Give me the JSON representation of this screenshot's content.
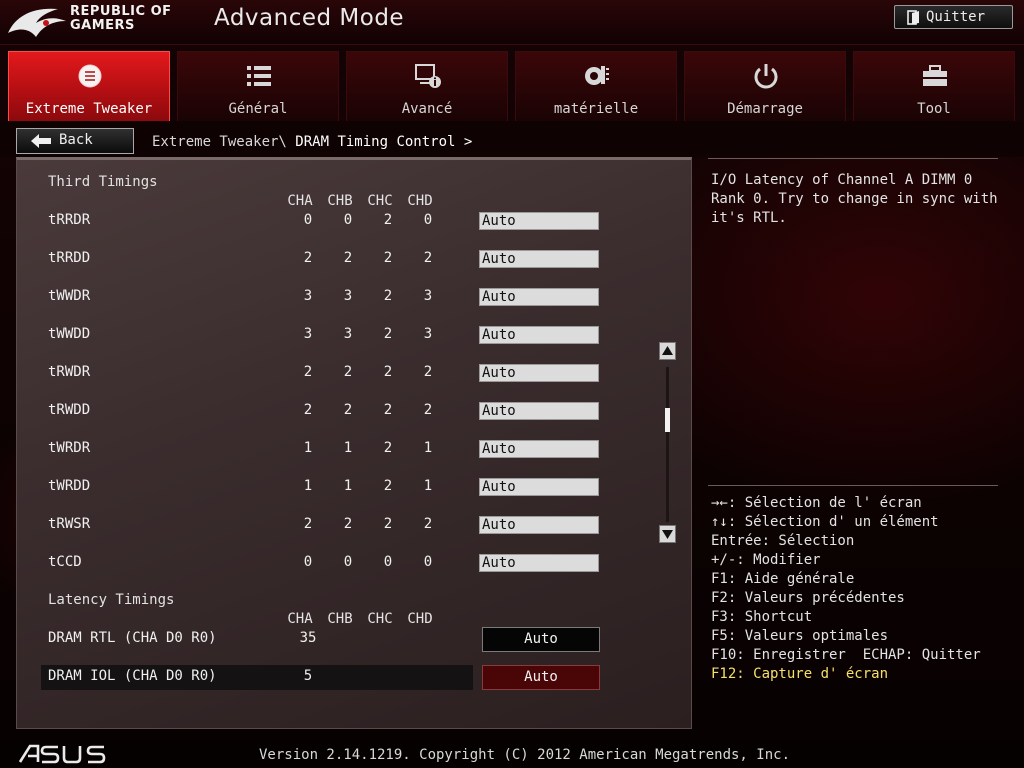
{
  "header": {
    "brand_line1": "REPUBLIC OF",
    "brand_line2": "GAMERS",
    "title": "Advanced Mode",
    "quit_label": "Quitter"
  },
  "tabs": [
    {
      "label": "Extreme Tweaker",
      "icon": "tweaker-icon",
      "active": true
    },
    {
      "label": "Général",
      "icon": "list-icon",
      "active": false
    },
    {
      "label": "Avancé",
      "icon": "advanced-icon",
      "active": false
    },
    {
      "label": "matérielle",
      "icon": "monitor-icon",
      "active": false
    },
    {
      "label": "Démarrage",
      "icon": "power-icon",
      "active": false
    },
    {
      "label": "Tool",
      "icon": "toolbox-icon",
      "active": false
    }
  ],
  "nav": {
    "back_label": "Back",
    "breadcrumb_prefix": "Extreme Tweaker\\",
    "breadcrumb_current": "DRAM Timing Control >"
  },
  "third_timings": {
    "title": "Third Timings",
    "columns": [
      "CHA",
      "CHB",
      "CHC",
      "CHD"
    ],
    "rows": [
      {
        "label": "tRRDR",
        "values": [
          "0",
          "0",
          "2",
          "0"
        ],
        "setting": "Auto"
      },
      {
        "label": "tRRDD",
        "values": [
          "2",
          "2",
          "2",
          "2"
        ],
        "setting": "Auto"
      },
      {
        "label": "tWWDR",
        "values": [
          "3",
          "3",
          "2",
          "3"
        ],
        "setting": "Auto"
      },
      {
        "label": "tWWDD",
        "values": [
          "3",
          "3",
          "2",
          "3"
        ],
        "setting": "Auto"
      },
      {
        "label": "tRWDR",
        "values": [
          "2",
          "2",
          "2",
          "2"
        ],
        "setting": "Auto"
      },
      {
        "label": "tRWDD",
        "values": [
          "2",
          "2",
          "2",
          "2"
        ],
        "setting": "Auto"
      },
      {
        "label": "tWRDR",
        "values": [
          "1",
          "1",
          "2",
          "1"
        ],
        "setting": "Auto"
      },
      {
        "label": "tWRDD",
        "values": [
          "1",
          "1",
          "2",
          "1"
        ],
        "setting": "Auto"
      },
      {
        "label": "tRWSR",
        "values": [
          "2",
          "2",
          "2",
          "2"
        ],
        "setting": "Auto"
      },
      {
        "label": "tCCD",
        "values": [
          "0",
          "0",
          "0",
          "0"
        ],
        "setting": "Auto"
      }
    ]
  },
  "latency_timings": {
    "title": "Latency Timings",
    "columns": [
      "CHA",
      "CHB",
      "CHC",
      "CHD"
    ],
    "rows": [
      {
        "label": "DRAM RTL (CHA D0 R0)",
        "value": "35",
        "setting": "Auto"
      },
      {
        "label": "DRAM IOL (CHA D0 R0)",
        "value": "5",
        "setting": "Auto"
      }
    ]
  },
  "help": {
    "description": "I/O Latency of Channel A DIMM 0 Rank 0. Try to change in sync with it's RTL."
  },
  "keys": [
    "→←: Sélection de l' écran",
    "↑↓: Sélection d' un élément",
    "Entrée: Sélection",
    "+/-: Modifier",
    "F1: Aide générale",
    "F2: Valeurs précédentes",
    "F3: Shortcut",
    "F5: Valeurs optimales",
    "F10: Enregistrer  ECHAP: Quitter",
    "F12: Capture d' écran"
  ],
  "footer": {
    "version": "Version 2.14.1219. Copyright (C) 2012 American Megatrends, Inc."
  },
  "colors": {
    "accent_red": "#d4161a",
    "highlight_yellow": "#f5e06a"
  }
}
